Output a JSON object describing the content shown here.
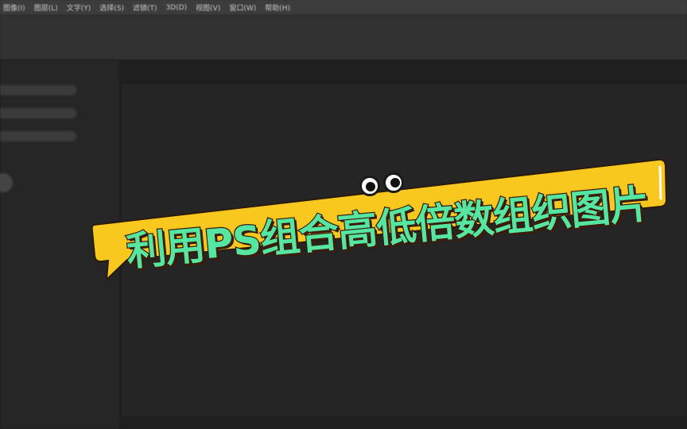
{
  "menubar": {
    "items": [
      "图像(I)",
      "图层(L)",
      "文字(Y)",
      "选择(S)",
      "滤镜(T)",
      "3D(D)",
      "视图(V)",
      "窗口(W)",
      "帮助(H)"
    ]
  },
  "banner": {
    "title": "利用PS组合高低倍数组织图片",
    "fill_color": "#f9c81e",
    "text_color": "#55e6a2",
    "outline_color": "#3a1d0c"
  },
  "colors": {
    "menubar_bg": "#3c3c3c",
    "workspace_bg": "#1f1f1f",
    "canvas_bg": "#252525"
  }
}
